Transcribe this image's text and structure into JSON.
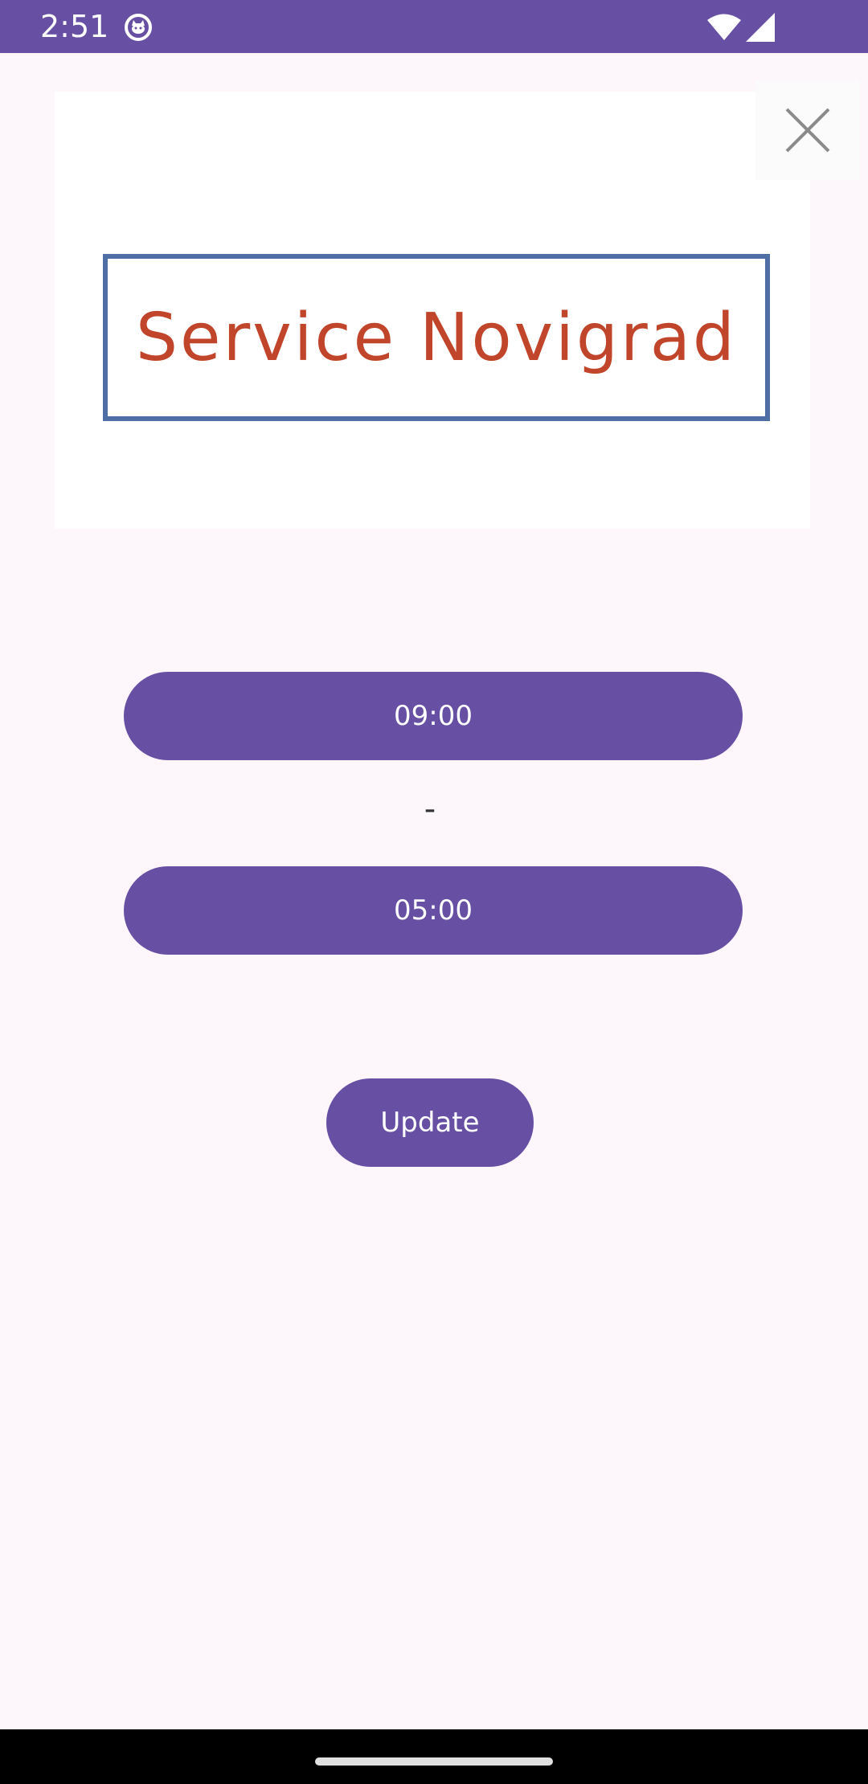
{
  "status_bar": {
    "time": "2:51",
    "background_color": "#6750a4",
    "icons": [
      "app-notification-icon",
      "wifi-icon",
      "signal-icon"
    ]
  },
  "logo": {
    "text": "Service Novigrad",
    "text_color": "#c0452a",
    "frame_color": "#4f6ea5"
  },
  "close_button": {
    "icon": "close-icon"
  },
  "hours": {
    "start_time": "09:00",
    "separator": "-",
    "end_time": "05:00"
  },
  "actions": {
    "update_label": "Update"
  },
  "theme": {
    "accent": "#6750a4",
    "background": "#fdf7fb",
    "on_accent": "#ffffff"
  }
}
